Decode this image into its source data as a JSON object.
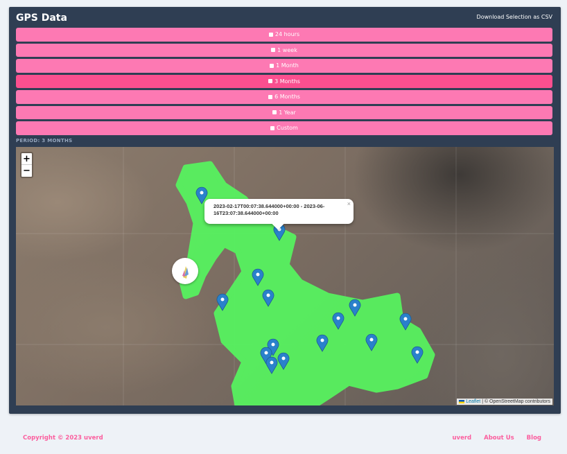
{
  "header": {
    "title": "GPS Data",
    "csv_link": "Download Selection as CSV"
  },
  "periods": [
    {
      "label": "24 hours",
      "active": false
    },
    {
      "label": "1 week",
      "active": false
    },
    {
      "label": "1 Month",
      "active": false
    },
    {
      "label": "3 Months",
      "active": true
    },
    {
      "label": "6 Months",
      "active": false
    },
    {
      "label": "1 Year",
      "active": false
    },
    {
      "label": "Custom",
      "active": false
    }
  ],
  "period_label": "PERIOD: 3 MONTHS",
  "map": {
    "zoom_in": "+",
    "zoom_out": "−",
    "popup_text": "2023-02-17T00:07:38.644000+00:00 - 2023-06-16T23:07:38.644000+00:00",
    "popup_close": "×",
    "attribution_leaflet": "Leaflet",
    "attribution_rest": " | © OpenStreetMap contributors",
    "track_color": "#57f25f",
    "marker_color": "#2a81cb"
  },
  "footer": {
    "copyright": "Copyright © 2023 uverd",
    "links": [
      "uverd",
      "About Us",
      "Blog"
    ]
  }
}
